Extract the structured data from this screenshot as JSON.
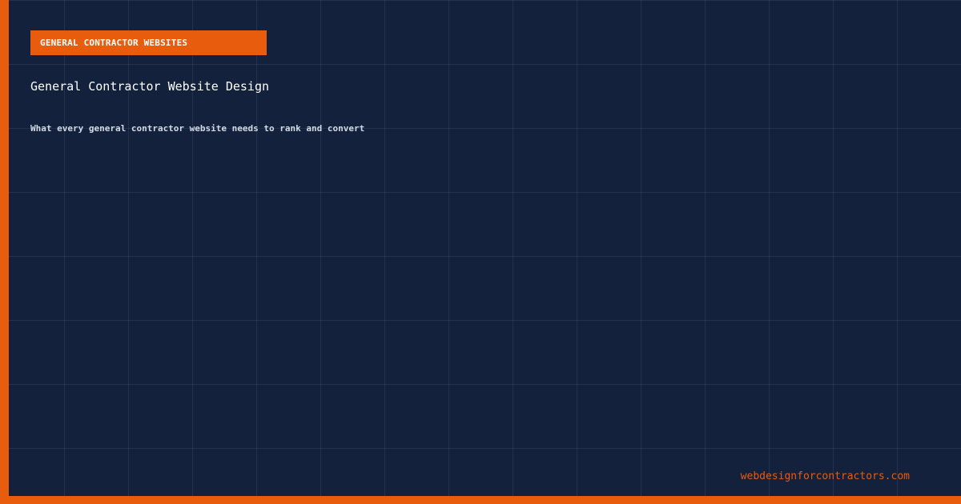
{
  "card": {
    "tag": "GENERAL CONTRACTOR WEBSITES",
    "title": "General Contractor Website Design",
    "subtitle": "What every general contractor website needs to rank and convert",
    "domain": "webdesignforcontractors.com"
  },
  "colors": {
    "background": "#13213c",
    "accent": "#e85c0d",
    "title_text": "#ffffff",
    "subtitle_text": "#d4dae4"
  }
}
